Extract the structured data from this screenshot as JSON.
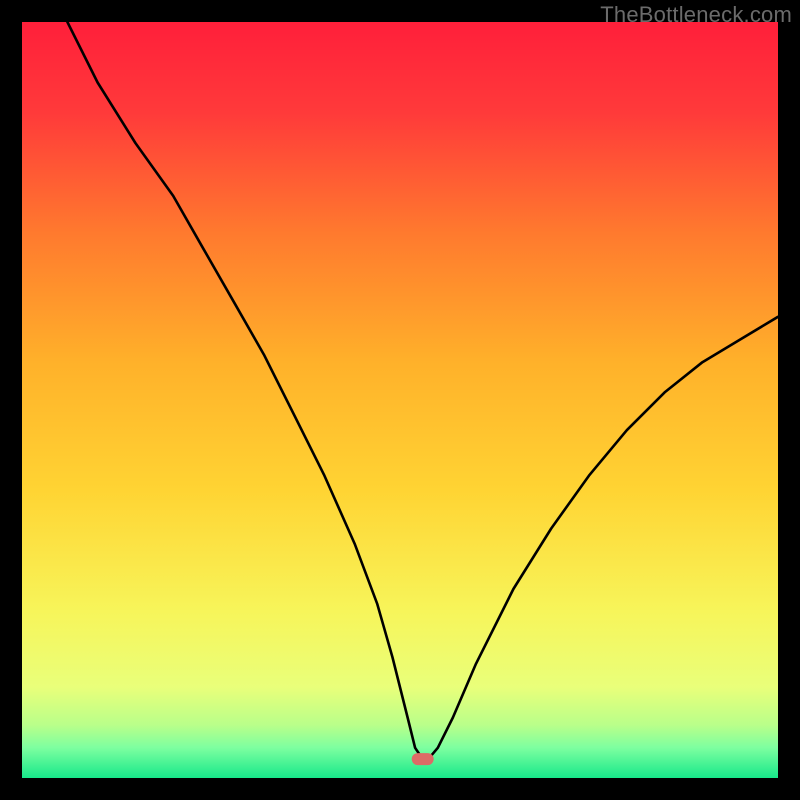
{
  "watermark": "TheBottleneck.com",
  "chart_data": {
    "type": "line",
    "title": "",
    "xlabel": "",
    "ylabel": "",
    "xlim": [
      0,
      100
    ],
    "ylim": [
      0,
      100
    ],
    "grid": false,
    "legend": false,
    "marker": {
      "x": 53,
      "y": 2.5,
      "color": "#dd6b66"
    },
    "background": "rainbow-vertical",
    "y_scale_note": "y = bottleneck %, 0 at bottom (green), ~100 at top (red)",
    "series": [
      {
        "name": "bottleneck-curve",
        "x": [
          6,
          10,
          15,
          20,
          24,
          28,
          32,
          36,
          40,
          44,
          47,
          49,
          51,
          52,
          53,
          54,
          55,
          57,
          60,
          65,
          70,
          75,
          80,
          85,
          90,
          95,
          100
        ],
        "y": [
          100,
          92,
          84,
          77,
          70,
          63,
          56,
          48,
          40,
          31,
          23,
          16,
          8,
          4,
          2.5,
          2.8,
          4,
          8,
          15,
          25,
          33,
          40,
          46,
          51,
          55,
          58,
          61
        ]
      }
    ]
  }
}
